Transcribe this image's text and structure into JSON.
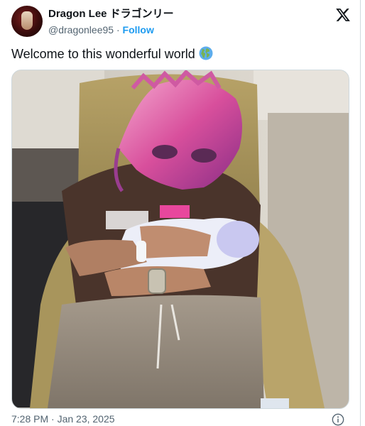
{
  "author": {
    "display_name": "Dragon Lee ドラゴンリー",
    "handle": "@dragonlee95",
    "separator": " · ",
    "follow_label": "Follow"
  },
  "tweet": {
    "text": "Welcome to this wonderful world",
    "emoji_icon": "globe-americas-icon"
  },
  "media": {
    "description_icon": "photo"
  },
  "meta": {
    "timestamp": "7:28 PM · Jan 23, 2025",
    "info_icon": "info-icon"
  },
  "colors": {
    "link_blue": "#1d9bf0",
    "secondary_text": "#536471",
    "border": "#cfd9de"
  }
}
